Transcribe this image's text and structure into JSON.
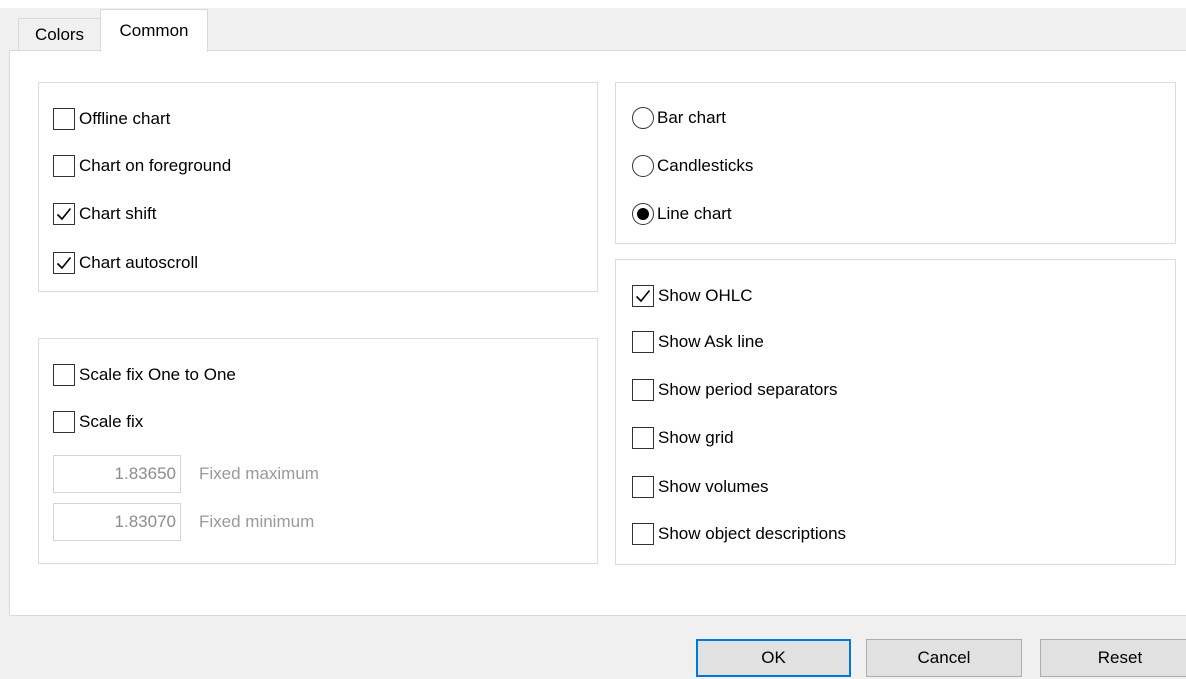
{
  "tabs": [
    {
      "label": "Colors",
      "active": false
    },
    {
      "label": "Common",
      "active": true
    }
  ],
  "chart_options": [
    {
      "label": "Offline chart",
      "checked": false
    },
    {
      "label": "Chart on foreground",
      "checked": false
    },
    {
      "label": "Chart shift",
      "checked": true
    },
    {
      "label": "Chart autoscroll",
      "checked": true
    }
  ],
  "scale_options": [
    {
      "label": "Scale fix One to One",
      "checked": false
    },
    {
      "label": "Scale fix",
      "checked": false
    }
  ],
  "fixed_fields": [
    {
      "value": "1.83650",
      "label": "Fixed maximum",
      "enabled": false
    },
    {
      "value": "1.83070",
      "label": "Fixed minimum",
      "enabled": false
    }
  ],
  "chart_type": {
    "options": [
      "Bar chart",
      "Candlesticks",
      "Line chart"
    ],
    "selected": "Line chart"
  },
  "show_options": [
    {
      "label": "Show OHLC",
      "checked": true
    },
    {
      "label": "Show Ask line",
      "checked": false
    },
    {
      "label": "Show period separators",
      "checked": false
    },
    {
      "label": "Show grid",
      "checked": false
    },
    {
      "label": "Show volumes",
      "checked": false
    },
    {
      "label": "Show object descriptions",
      "checked": false
    }
  ],
  "buttons": {
    "ok": "OK",
    "cancel": "Cancel",
    "reset": "Reset"
  },
  "colors": {
    "focus_border": "#0078d7",
    "panel_bg": "#ffffff",
    "dialog_bg": "#f0f0f0"
  }
}
